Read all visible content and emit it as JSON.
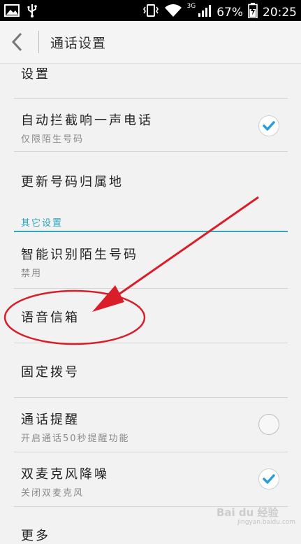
{
  "status_bar": {
    "network": "3G",
    "battery": "67%",
    "time": "20:25"
  },
  "action_bar": {
    "title": "通话设置"
  },
  "items": [
    {
      "title": "设置"
    },
    {
      "title": "自动拦截响一声电话",
      "subtitle": "仅限陌生号码",
      "checked": true
    },
    {
      "title": "更新号码归属地"
    },
    {
      "section": "其它设置"
    },
    {
      "title": "智能识别陌生号码",
      "subtitle": "禁用"
    },
    {
      "title": "语音信箱"
    },
    {
      "title": "固定拨号"
    },
    {
      "title": "通话提醒",
      "subtitle": "开启通话50秒提醒功能",
      "checked": false
    },
    {
      "title": "双麦克风降噪",
      "subtitle": "关闭双麦克风",
      "checked": true
    },
    {
      "title": "更多"
    }
  ],
  "watermark": {
    "brand": "Bai du 经验",
    "url": "jingyan.baidu.com"
  },
  "colors": {
    "accent": "#33a6ba",
    "annotation": "#d91e2a",
    "check": "#2a9ed6"
  }
}
